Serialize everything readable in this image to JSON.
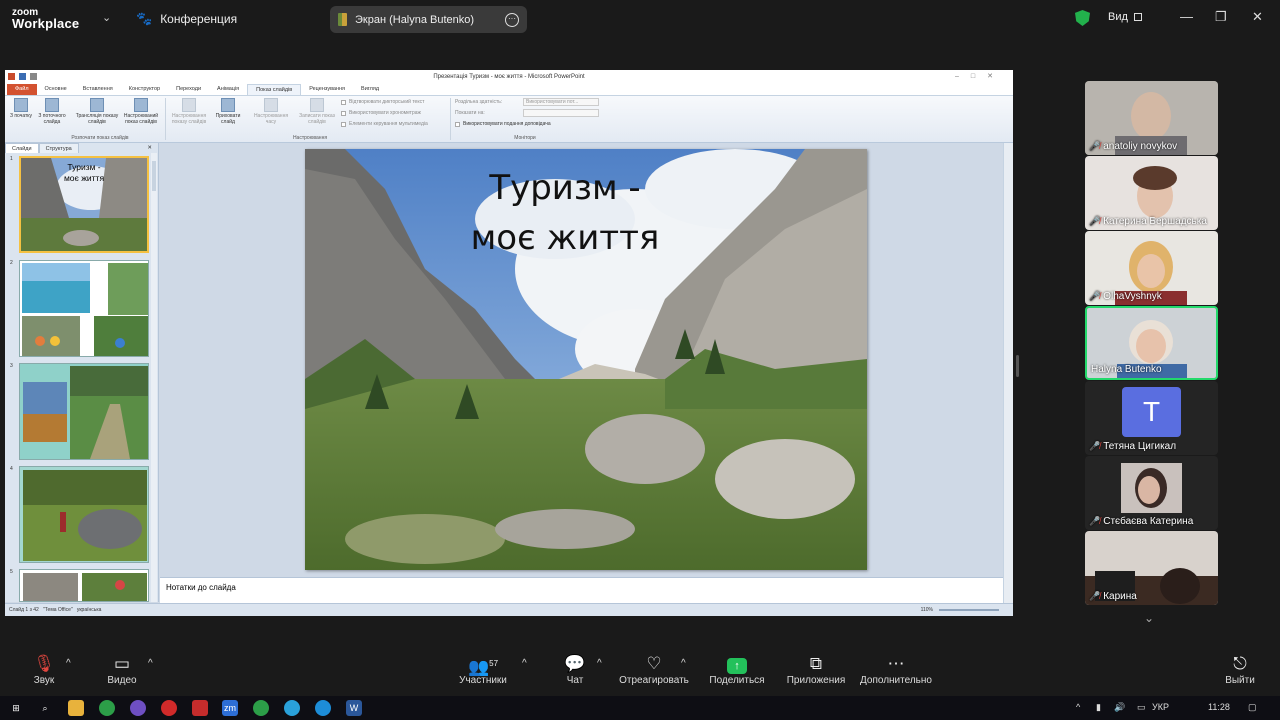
{
  "zoom": {
    "logo_line1": "zoom",
    "logo_line2": "Workplace",
    "meeting_title": "Конференция",
    "share_pill": "Экран (Halyna Butenko)",
    "view_label": "Вид"
  },
  "ppt": {
    "window_title": "Презентація Туризм - моє життя  -  Microsoft PowerPoint",
    "tabs": [
      "Файл",
      "Основне",
      "Вставлення",
      "Конструктор",
      "Переходи",
      "Анімація",
      "Показ слайдів",
      "Рецензування",
      "Вигляд"
    ],
    "ribbon": {
      "btn_from_start": "З початку",
      "btn_from_current": "З поточного слайда",
      "btn_broadcast": "Трансляція показу слайдів",
      "btn_custom": "Настроюваний показ слайдів",
      "group1": "Розпочати показ слайдів",
      "btn_setup": "Настроювання показу слайдів",
      "btn_hide": "Приховати слайд",
      "btn_rehearse": "Настроювання часу",
      "btn_record": "Записати показ слайдів",
      "group2": "Настроювання",
      "chk_narrations": "Відтворювати дикторський текст",
      "chk_timings": "Використовувати хронометраж",
      "chk_media": "Елементи керування мультимедіа",
      "resolution_label": "Роздільна здатність:",
      "resolution_value": "Використовувати пот...",
      "show_on_label": "Показати на:",
      "presenter_view": "Використовувати подання доповідача",
      "group3": "Монітори"
    },
    "panel_tabs": [
      "Слайди",
      "Структура"
    ],
    "thumb1_title_line1": "Туризм -",
    "thumb1_title_line2": "моє життя",
    "thumb_numbers": [
      "1",
      "2",
      "3",
      "4",
      "5"
    ],
    "slide_title_line1": "Туризм -",
    "slide_title_line2": "моє життя",
    "notes_placeholder": "Нотатки до слайда",
    "status_slide": "Слайд 1 з 42",
    "status_theme": "\"Тема Office\"",
    "status_lang": "українська",
    "status_zoom": "110%"
  },
  "participants": [
    {
      "name": "anatoliy novykov",
      "muted": true
    },
    {
      "name": "Катерина Бершадська",
      "muted": true
    },
    {
      "name": "OlhaVyshnyk",
      "muted": true
    },
    {
      "name": "Halyna Butenko",
      "muted": false
    },
    {
      "name": "Тетяна Цигикал",
      "muted": true,
      "initial": "T"
    },
    {
      "name": "Стєбаєва Катерина",
      "muted": true
    },
    {
      "name": "Карина",
      "muted": true
    }
  ],
  "controls": {
    "audio": "Звук",
    "video": "Видео",
    "participants": "Участники",
    "participants_count": "57",
    "chat": "Чат",
    "react": "Отреагировать",
    "share": "Поделиться",
    "apps": "Приложения",
    "more": "Дополнительно",
    "leave": "Выйти"
  },
  "taskbar": {
    "lang": "УКР",
    "time": "11:28"
  }
}
